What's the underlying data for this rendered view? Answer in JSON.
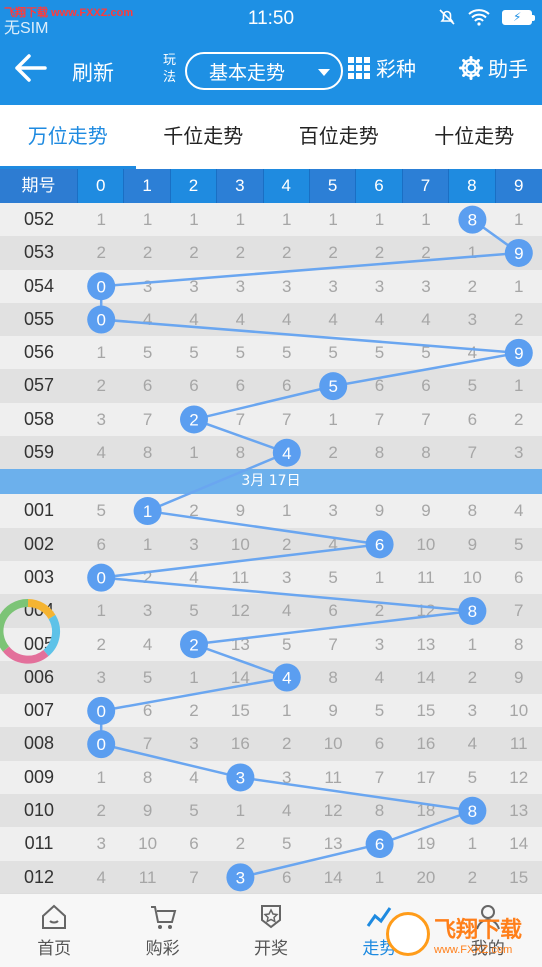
{
  "status_bar": {
    "watermark": "飞翔下载 www.FXXZ.com",
    "sim": "无SIM",
    "time": "11:50",
    "battery": "⚡"
  },
  "header": {
    "refresh_label": "刷新",
    "play_label": "玩法",
    "play_value": "基本走势",
    "lottery_label": "彩种",
    "helper_label": "助手"
  },
  "tabs": [
    {
      "label": "万位走势",
      "active": true
    },
    {
      "label": "千位走势",
      "active": false
    },
    {
      "label": "百位走势",
      "active": false
    },
    {
      "label": "十位走势",
      "active": false
    }
  ],
  "table": {
    "header_issue": "期号",
    "header_digits": [
      "0",
      "1",
      "2",
      "3",
      "4",
      "5",
      "6",
      "7",
      "8",
      "9"
    ],
    "group1": [
      {
        "issue": "052",
        "cells": [
          "1",
          "1",
          "1",
          "1",
          "1",
          "1",
          "1",
          "1",
          "8",
          "1"
        ],
        "hit": 8
      },
      {
        "issue": "053",
        "cells": [
          "2",
          "2",
          "2",
          "2",
          "2",
          "2",
          "2",
          "2",
          "1",
          "9"
        ],
        "hit": 9
      },
      {
        "issue": "054",
        "cells": [
          "0",
          "3",
          "3",
          "3",
          "3",
          "3",
          "3",
          "3",
          "2",
          "1"
        ],
        "hit": 0
      },
      {
        "issue": "055",
        "cells": [
          "0",
          "4",
          "4",
          "4",
          "4",
          "4",
          "4",
          "4",
          "3",
          "2"
        ],
        "hit": 0
      },
      {
        "issue": "056",
        "cells": [
          "1",
          "5",
          "5",
          "5",
          "5",
          "5",
          "5",
          "5",
          "4",
          "9"
        ],
        "hit": 9
      },
      {
        "issue": "057",
        "cells": [
          "2",
          "6",
          "6",
          "6",
          "6",
          "5",
          "6",
          "6",
          "5",
          "1"
        ],
        "hit": 5
      },
      {
        "issue": "058",
        "cells": [
          "3",
          "7",
          "2",
          "7",
          "7",
          "1",
          "7",
          "7",
          "6",
          "2"
        ],
        "hit": 2
      },
      {
        "issue": "059",
        "cells": [
          "4",
          "8",
          "1",
          "8",
          "4",
          "2",
          "8",
          "8",
          "7",
          "3"
        ],
        "hit": 4
      }
    ],
    "date_divider": "3月 17日",
    "group2": [
      {
        "issue": "001",
        "cells": [
          "5",
          "1",
          "2",
          "9",
          "1",
          "3",
          "9",
          "9",
          "8",
          "4"
        ],
        "hit": 1
      },
      {
        "issue": "002",
        "cells": [
          "6",
          "1",
          "3",
          "10",
          "2",
          "4",
          "6",
          "10",
          "9",
          "5"
        ],
        "hit": 6
      },
      {
        "issue": "003",
        "cells": [
          "0",
          "2",
          "4",
          "11",
          "3",
          "5",
          "1",
          "11",
          "10",
          "6"
        ],
        "hit": 0
      },
      {
        "issue": "004",
        "cells": [
          "1",
          "3",
          "5",
          "12",
          "4",
          "6",
          "2",
          "12",
          "8",
          "7"
        ],
        "hit": 8
      },
      {
        "issue": "005",
        "cells": [
          "2",
          "4",
          "2",
          "13",
          "5",
          "7",
          "3",
          "13",
          "1",
          "8"
        ],
        "hit": 2
      },
      {
        "issue": "006",
        "cells": [
          "3",
          "5",
          "1",
          "14",
          "4",
          "8",
          "4",
          "14",
          "2",
          "9"
        ],
        "hit": 4
      },
      {
        "issue": "007",
        "cells": [
          "0",
          "6",
          "2",
          "15",
          "1",
          "9",
          "5",
          "15",
          "3",
          "10"
        ],
        "hit": 0
      },
      {
        "issue": "008",
        "cells": [
          "0",
          "7",
          "3",
          "16",
          "2",
          "10",
          "6",
          "16",
          "4",
          "11"
        ],
        "hit": 0
      },
      {
        "issue": "009",
        "cells": [
          "1",
          "8",
          "4",
          "3",
          "3",
          "11",
          "7",
          "17",
          "5",
          "12"
        ],
        "hit": 3
      },
      {
        "issue": "010",
        "cells": [
          "2",
          "9",
          "5",
          "1",
          "4",
          "12",
          "8",
          "18",
          "8",
          "13"
        ],
        "hit": 8
      },
      {
        "issue": "011",
        "cells": [
          "3",
          "10",
          "6",
          "2",
          "5",
          "13",
          "6",
          "19",
          "1",
          "14"
        ],
        "hit": 6
      },
      {
        "issue": "012",
        "cells": [
          "4",
          "11",
          "7",
          "3",
          "6",
          "14",
          "1",
          "20",
          "2",
          "15"
        ],
        "hit": 3
      }
    ]
  },
  "bottom_nav": [
    {
      "label": "首页",
      "icon": "home-icon",
      "active": false
    },
    {
      "label": "购彩",
      "icon": "cart-icon",
      "active": false
    },
    {
      "label": "开奖",
      "icon": "award-icon",
      "active": false
    },
    {
      "label": "走势",
      "icon": "trend-icon",
      "active": true
    },
    {
      "label": "我的",
      "icon": "user-icon",
      "active": false
    }
  ],
  "overlay_watermark": {
    "title": "飞翔下载",
    "url": "www.FXXZ.com"
  },
  "colors": {
    "primary": "#1e90e4",
    "ball": "#5b9ef0",
    "line": "#6aa6f0"
  }
}
